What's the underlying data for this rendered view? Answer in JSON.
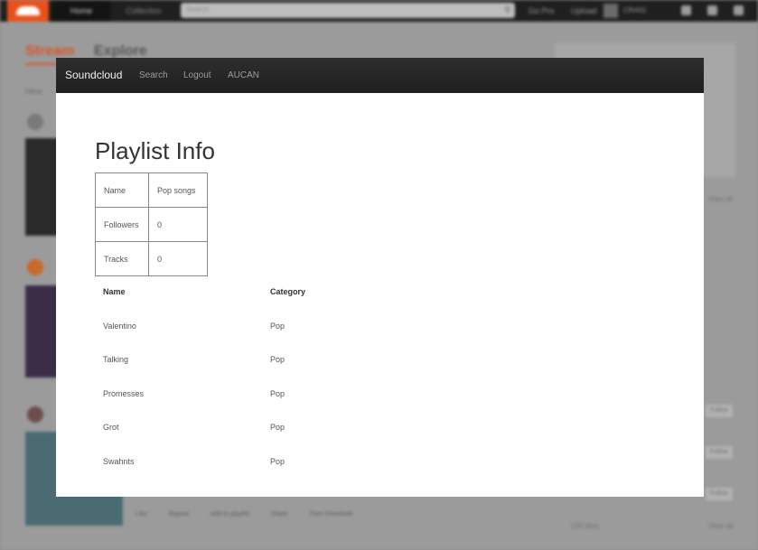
{
  "background": {
    "topbar": {
      "home": "Home",
      "collection": "Collection",
      "search_placeholder": "Search",
      "go_pro": "Go Pro",
      "upload": "Upload",
      "user": "CRAIG"
    },
    "tabs": {
      "stream": "Stream",
      "explore": "Explore"
    },
    "hear": "Hear",
    "sidebar": {
      "view_all_1": "View all",
      "view_all_2": "View all",
      "likes_count": "226 likes",
      "follow": "Follow"
    },
    "actions": [
      "Like",
      "Repost",
      "Add to playlist",
      "Share",
      "Free Download"
    ]
  },
  "navbar": {
    "brand": "Soundcloud",
    "links": [
      "Search",
      "Logout",
      "AUCAN"
    ]
  },
  "title": "Playlist Info",
  "info": [
    {
      "key": "Name",
      "value": "Pop songs"
    },
    {
      "key": "Followers",
      "value": "0"
    },
    {
      "key": "Tracks",
      "value": "0"
    }
  ],
  "tracks_header": {
    "name": "Name",
    "category": "Category"
  },
  "tracks": [
    {
      "name": "Valentino",
      "category": "Pop"
    },
    {
      "name": "Talking",
      "category": "Pop"
    },
    {
      "name": "Promesses",
      "category": "Pop"
    },
    {
      "name": "Grot",
      "category": "Pop"
    },
    {
      "name": "Swahnts",
      "category": "Pop"
    }
  ]
}
